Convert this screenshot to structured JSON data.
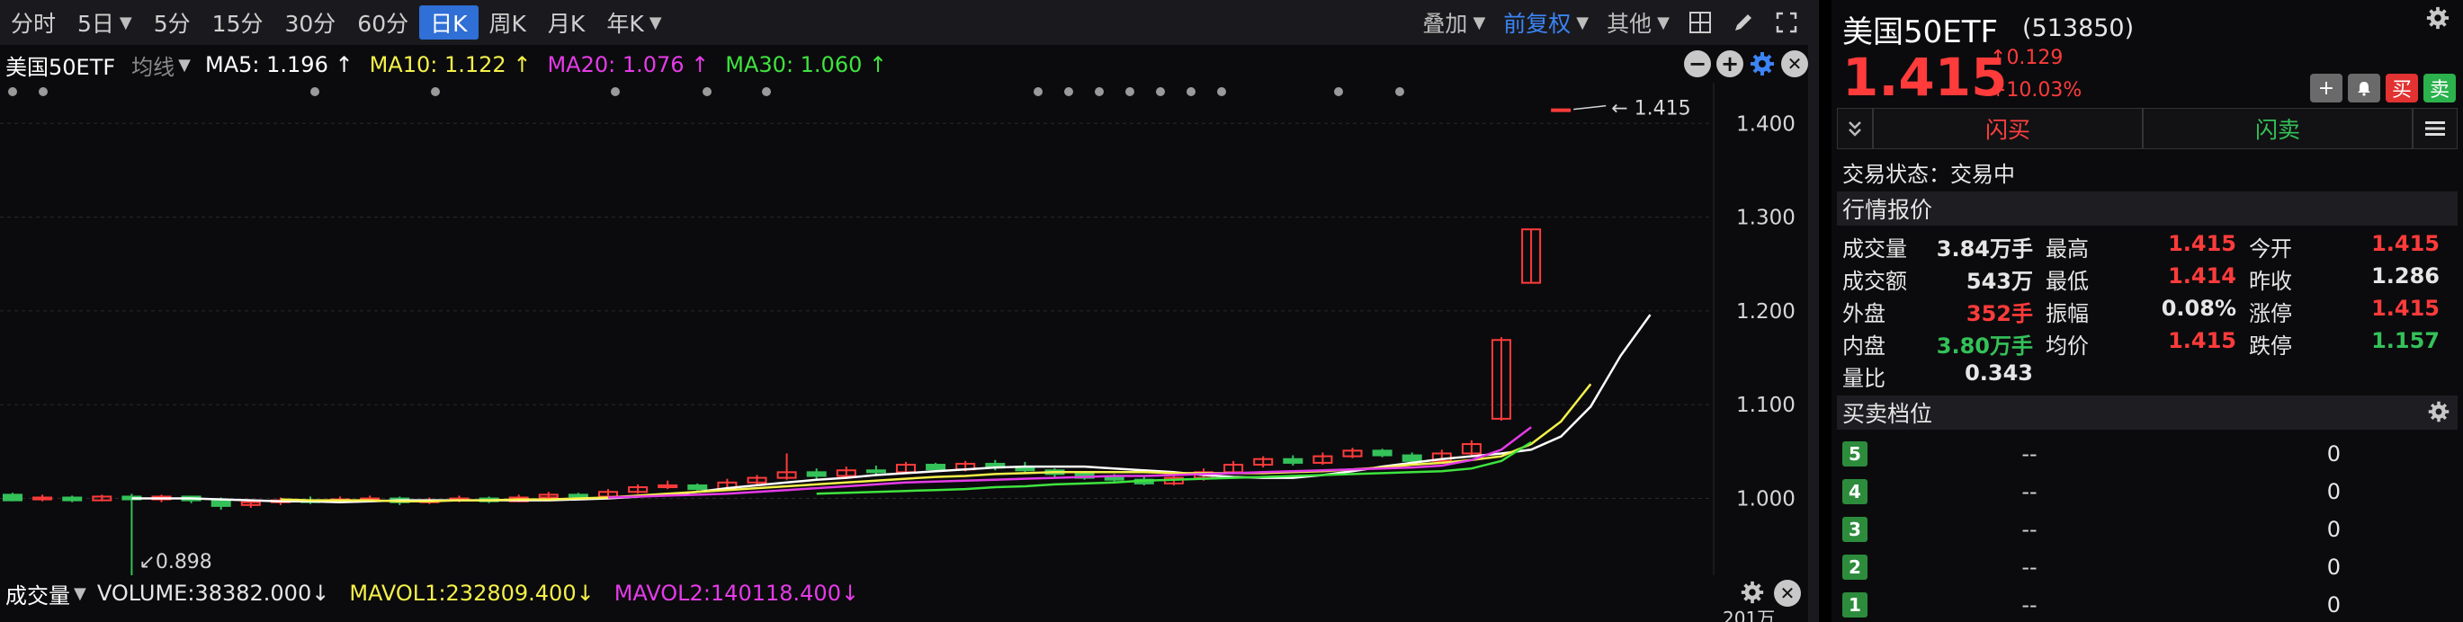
{
  "periods": {
    "tabs": [
      "分时",
      "5日",
      "5分",
      "15分",
      "30分",
      "60分",
      "日K",
      "周K",
      "月K",
      "年K"
    ],
    "dropdown_tabs": [
      1,
      9
    ],
    "active_index": 6
  },
  "toolbar": {
    "overlay_label": "叠加",
    "adjust_label": "前复权",
    "other_label": "其他"
  },
  "ma_bar": {
    "symbol": "美国50ETF",
    "type_label": "均线",
    "ma5": "MA5: 1.196",
    "ma10": "MA10: 1.122",
    "ma20": "MA20: 1.076",
    "ma30": "MA30: 1.060",
    "colors": {
      "ma5": "#ffffff",
      "ma10": "#f5f04a",
      "ma20": "#e53be8",
      "ma30": "#3ee43e"
    }
  },
  "volume_bar": {
    "label": "成交量",
    "volume": "VOLUME:38382.000",
    "mavol1": "MAVOL1:232809.400",
    "mavol2": "MAVOL2:140118.400",
    "scale_label": "201万"
  },
  "chart_data": {
    "type": "candlestick",
    "ylim": [
      0.92,
      1.43
    ],
    "y_ticks": [
      "1.400",
      "1.300",
      "1.200",
      "1.100",
      "1.000"
    ],
    "y_tick_values": [
      1.4,
      1.3,
      1.2,
      1.1,
      1.0
    ],
    "annotations": {
      "high_label": "1.415",
      "high_value": 1.415,
      "low_label": "0.898",
      "low_value": 0.898
    },
    "candles": [
      [
        1.004,
        0.998,
        1.006,
        0.997
      ],
      [
        0.999,
        1.001,
        1.004,
        0.997
      ],
      [
        1.001,
        0.998,
        1.003,
        0.996
      ],
      [
        0.998,
        1.002,
        1.004,
        0.997
      ],
      [
        1.002,
        0.999,
        1.005,
        0.898
      ],
      [
        0.999,
        1.002,
        1.004,
        0.996
      ],
      [
        1.002,
        0.998,
        1.003,
        0.995
      ],
      [
        0.998,
        0.992,
        1.001,
        0.988
      ],
      [
        0.993,
        0.996,
        0.999,
        0.99
      ],
      [
        0.996,
        0.998,
        1.001,
        0.993
      ],
      [
        0.998,
        0.997,
        1.002,
        0.994
      ],
      [
        0.997,
        0.999,
        1.002,
        0.995
      ],
      [
        0.999,
        1.0,
        1.003,
        0.996
      ],
      [
        1.0,
        0.996,
        1.002,
        0.993
      ],
      [
        0.996,
        0.998,
        1.001,
        0.994
      ],
      [
        0.998,
        1.0,
        1.003,
        0.996
      ],
      [
        1.0,
        0.997,
        1.002,
        0.995
      ],
      [
        0.997,
        1.001,
        1.004,
        0.996
      ],
      [
        1.001,
        1.004,
        1.007,
        0.999
      ],
      [
        1.004,
        1.002,
        1.006,
        1.0
      ],
      [
        1.002,
        1.007,
        1.01,
        1.001
      ],
      [
        1.007,
        1.012,
        1.015,
        1.005
      ],
      [
        1.012,
        1.014,
        1.019,
        1.01
      ],
      [
        1.014,
        1.01,
        1.016,
        1.008
      ],
      [
        1.01,
        1.017,
        1.021,
        1.008
      ],
      [
        1.017,
        1.022,
        1.025,
        1.015
      ],
      [
        1.022,
        1.028,
        1.048,
        1.02
      ],
      [
        1.028,
        1.024,
        1.032,
        1.021
      ],
      [
        1.024,
        1.03,
        1.034,
        1.022
      ],
      [
        1.03,
        1.028,
        1.035,
        1.025
      ],
      [
        1.028,
        1.036,
        1.039,
        1.026
      ],
      [
        1.036,
        1.031,
        1.038,
        1.029
      ],
      [
        1.031,
        1.037,
        1.04,
        1.029
      ],
      [
        1.037,
        1.033,
        1.041,
        1.03
      ],
      [
        1.033,
        1.03,
        1.039,
        1.027
      ],
      [
        1.03,
        1.026,
        1.032,
        1.023
      ],
      [
        1.026,
        1.022,
        1.028,
        1.02
      ],
      [
        1.022,
        1.02,
        1.026,
        1.017
      ],
      [
        1.02,
        1.016,
        1.023,
        1.014
      ],
      [
        1.016,
        1.022,
        1.026,
        1.014
      ],
      [
        1.022,
        1.028,
        1.032,
        1.019
      ],
      [
        1.028,
        1.036,
        1.04,
        1.026
      ],
      [
        1.036,
        1.042,
        1.045,
        1.033
      ],
      [
        1.042,
        1.038,
        1.046,
        1.035
      ],
      [
        1.038,
        1.045,
        1.049,
        1.036
      ],
      [
        1.045,
        1.051,
        1.054,
        1.043
      ],
      [
        1.051,
        1.046,
        1.053,
        1.044
      ],
      [
        1.046,
        1.04,
        1.049,
        1.038
      ],
      [
        1.04,
        1.048,
        1.052,
        1.038
      ],
      [
        1.048,
        1.058,
        1.062,
        1.046
      ],
      [
        1.085,
        1.169,
        1.172,
        1.083
      ],
      [
        1.23,
        1.287,
        1.287,
        1.23
      ],
      [
        1.414,
        1.415,
        1.415,
        1.414
      ]
    ],
    "ma_lines": {
      "ma5": {
        "start": 4,
        "values": [
          1.0,
          1.0,
          1.0,
          0.999,
          0.998,
          0.997,
          0.997,
          0.996,
          0.997,
          0.998,
          0.998,
          0.998,
          0.998,
          0.998,
          0.998,
          0.999,
          1.0,
          1.002,
          1.004,
          1.007,
          1.011,
          1.014,
          1.017,
          1.02,
          1.022,
          1.025,
          1.027,
          1.029,
          1.031,
          1.033,
          1.034,
          1.034,
          1.034,
          1.032,
          1.03,
          1.028,
          1.025,
          1.023,
          1.022,
          1.022,
          1.025,
          1.029,
          1.034,
          1.038,
          1.042,
          1.045,
          1.048,
          1.052,
          1.066,
          1.098,
          1.152,
          1.196
        ]
      },
      "ma10": {
        "start": 9,
        "values": [
          0.999,
          0.998,
          0.998,
          0.998,
          0.997,
          0.997,
          0.998,
          0.998,
          0.999,
          0.999,
          1.0,
          1.001,
          1.003,
          1.005,
          1.007,
          1.009,
          1.011,
          1.013,
          1.015,
          1.017,
          1.019,
          1.021,
          1.023,
          1.024,
          1.026,
          1.027,
          1.028,
          1.028,
          1.028,
          1.028,
          1.027,
          1.027,
          1.027,
          1.027,
          1.028,
          1.029,
          1.031,
          1.033,
          1.036,
          1.038,
          1.041,
          1.045,
          1.058,
          1.082,
          1.122
        ]
      },
      "ma20": {
        "start": 20,
        "values": [
          1.001,
          1.002,
          1.003,
          1.004,
          1.005,
          1.007,
          1.009,
          1.011,
          1.013,
          1.015,
          1.017,
          1.018,
          1.019,
          1.02,
          1.021,
          1.022,
          1.023,
          1.024,
          1.024,
          1.025,
          1.026,
          1.027,
          1.028,
          1.029,
          1.03,
          1.031,
          1.032,
          1.033,
          1.035,
          1.041,
          1.052,
          1.076
        ]
      },
      "ma30": {
        "start": 27,
        "values": [
          1.005,
          1.006,
          1.007,
          1.008,
          1.009,
          1.01,
          1.012,
          1.013,
          1.015,
          1.016,
          1.017,
          1.019,
          1.02,
          1.021,
          1.022,
          1.023,
          1.024,
          1.025,
          1.026,
          1.027,
          1.028,
          1.029,
          1.032,
          1.04,
          1.06
        ]
      }
    }
  },
  "quote": {
    "name": "美国50ETF",
    "code": "(513850)",
    "price": "1.415",
    "change": "0.129",
    "change_pct": "+10.03%",
    "flash_buy": "闪买",
    "flash_sell": "闪卖",
    "buy_btn": "买",
    "sell_btn": "卖",
    "trade_status": "交易状态：交易中",
    "quote_title": "行情报价",
    "rows": [
      [
        {
          "l": "成交量",
          "v": "3.84万手",
          "c": ""
        },
        {
          "l": "最高",
          "v": "1.415",
          "c": "red"
        },
        {
          "l": "今开",
          "v": "1.415",
          "c": "red"
        }
      ],
      [
        {
          "l": "成交额",
          "v": "543万",
          "c": ""
        },
        {
          "l": "最低",
          "v": "1.414",
          "c": "red"
        },
        {
          "l": "昨收",
          "v": "1.286",
          "c": ""
        }
      ],
      [
        {
          "l": "外盘",
          "v": "352手",
          "c": "red"
        },
        {
          "l": "振幅",
          "v": "0.08%",
          "c": ""
        },
        {
          "l": "涨停",
          "v": "1.415",
          "c": "red"
        }
      ],
      [
        {
          "l": "内盘",
          "v": "3.80万手",
          "c": "green"
        },
        {
          "l": "均价",
          "v": "1.415",
          "c": "red"
        },
        {
          "l": "跌停",
          "v": "1.157",
          "c": "green"
        }
      ],
      [
        {
          "l": "量比",
          "v": "0.343",
          "c": ""
        }
      ]
    ],
    "book_title": "买卖档位",
    "book": [
      {
        "level": "5",
        "price": "--",
        "vol": "0"
      },
      {
        "level": "4",
        "price": "--",
        "vol": "0"
      },
      {
        "level": "3",
        "price": "--",
        "vol": "0"
      },
      {
        "level": "2",
        "price": "--",
        "vol": "0"
      },
      {
        "level": "1",
        "price": "--",
        "vol": "0"
      }
    ]
  },
  "colors": {
    "up": "#ff3b3b",
    "down": "#34c159",
    "accent": "#2f6fd6"
  }
}
